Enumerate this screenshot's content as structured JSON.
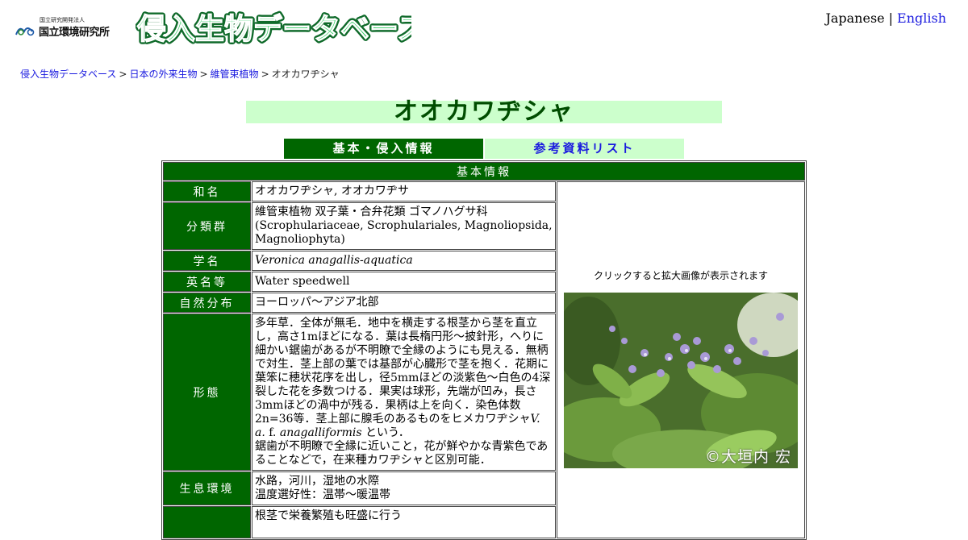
{
  "header": {
    "org_small": "国立研究開発法人",
    "org_name": "国立環境研究所",
    "site_title": "侵入生物データベース",
    "lang_japanese": "Japanese",
    "lang_separator": "|",
    "lang_english": "English"
  },
  "breadcrumb": {
    "items": [
      "侵入生物データベース",
      "日本の外来生物",
      "維管束植物"
    ],
    "separator": ">",
    "current": "オオカワヂシャ"
  },
  "title": "オオカワヂシャ",
  "tabs": {
    "basic": "基本・侵入情報",
    "refs": "参考資料リスト"
  },
  "table": {
    "section_header": "基本情報",
    "rows": [
      {
        "label": "和名",
        "value": "オオカワヂシャ, オオカワヂサ"
      },
      {
        "label": "分類群",
        "value": "維管束植物 双子葉・合弁花類 ゴマノハグサ科 (Scrophulariaceae, Scrophulariales, Magnoliopsida, Magnoliophyta)"
      },
      {
        "label": "学名",
        "value": "Veronica anagallis-aquatica"
      },
      {
        "label": "英名等",
        "value": "Water speedwell"
      },
      {
        "label": "自然分布",
        "value": "ヨーロッパ～アジア北部"
      },
      {
        "label": "形態",
        "value_part1": "多年草．全体が無毛．地中を横走する根茎から茎を直立し，高さ1mほどになる．葉は長楕円形～披針形，へりに細かい鋸歯があるが不明瞭で全縁のようにも見える．無柄で対生．茎上部の葉では基部が心臓形で茎を抱く．花期に葉笨に穂状花序を出し，径5mmほどの淡紫色～白色の4深裂した花を多数つける．果実は球形，先端が凹み，長さ3mmほどの渦中が残る．果柄は上を向く．染色体数2n=36等．茎上部に腺毛のあるものをヒメカワヂシャ",
        "value_italic1": "V. a.",
        "value_part2": " f. ",
        "value_italic2": "anagalliformis",
        "value_part3": " という．",
        "value_line2": "鋸歯が不明瞭で全縁に近いこと，花が鮮やかな青紫色であることなどで，在来種カワヂシャと区別可能．"
      },
      {
        "label": "生息環境",
        "value_line1": "水路，河川，湿地の水際",
        "value_line2": "温度選好性：温帯～暖温帯"
      },
      {
        "label": "",
        "value": "根茎で栄養繁殖も旺盛に行う"
      }
    ],
    "photo_caption": "クリックすると拡大画像が表示されます",
    "photo_credit": "©大垣内 宏"
  },
  "colors": {
    "dark_green": "#006600",
    "light_green": "#ccffcc",
    "title_text": "#004d00",
    "link": "#1a1adf"
  }
}
